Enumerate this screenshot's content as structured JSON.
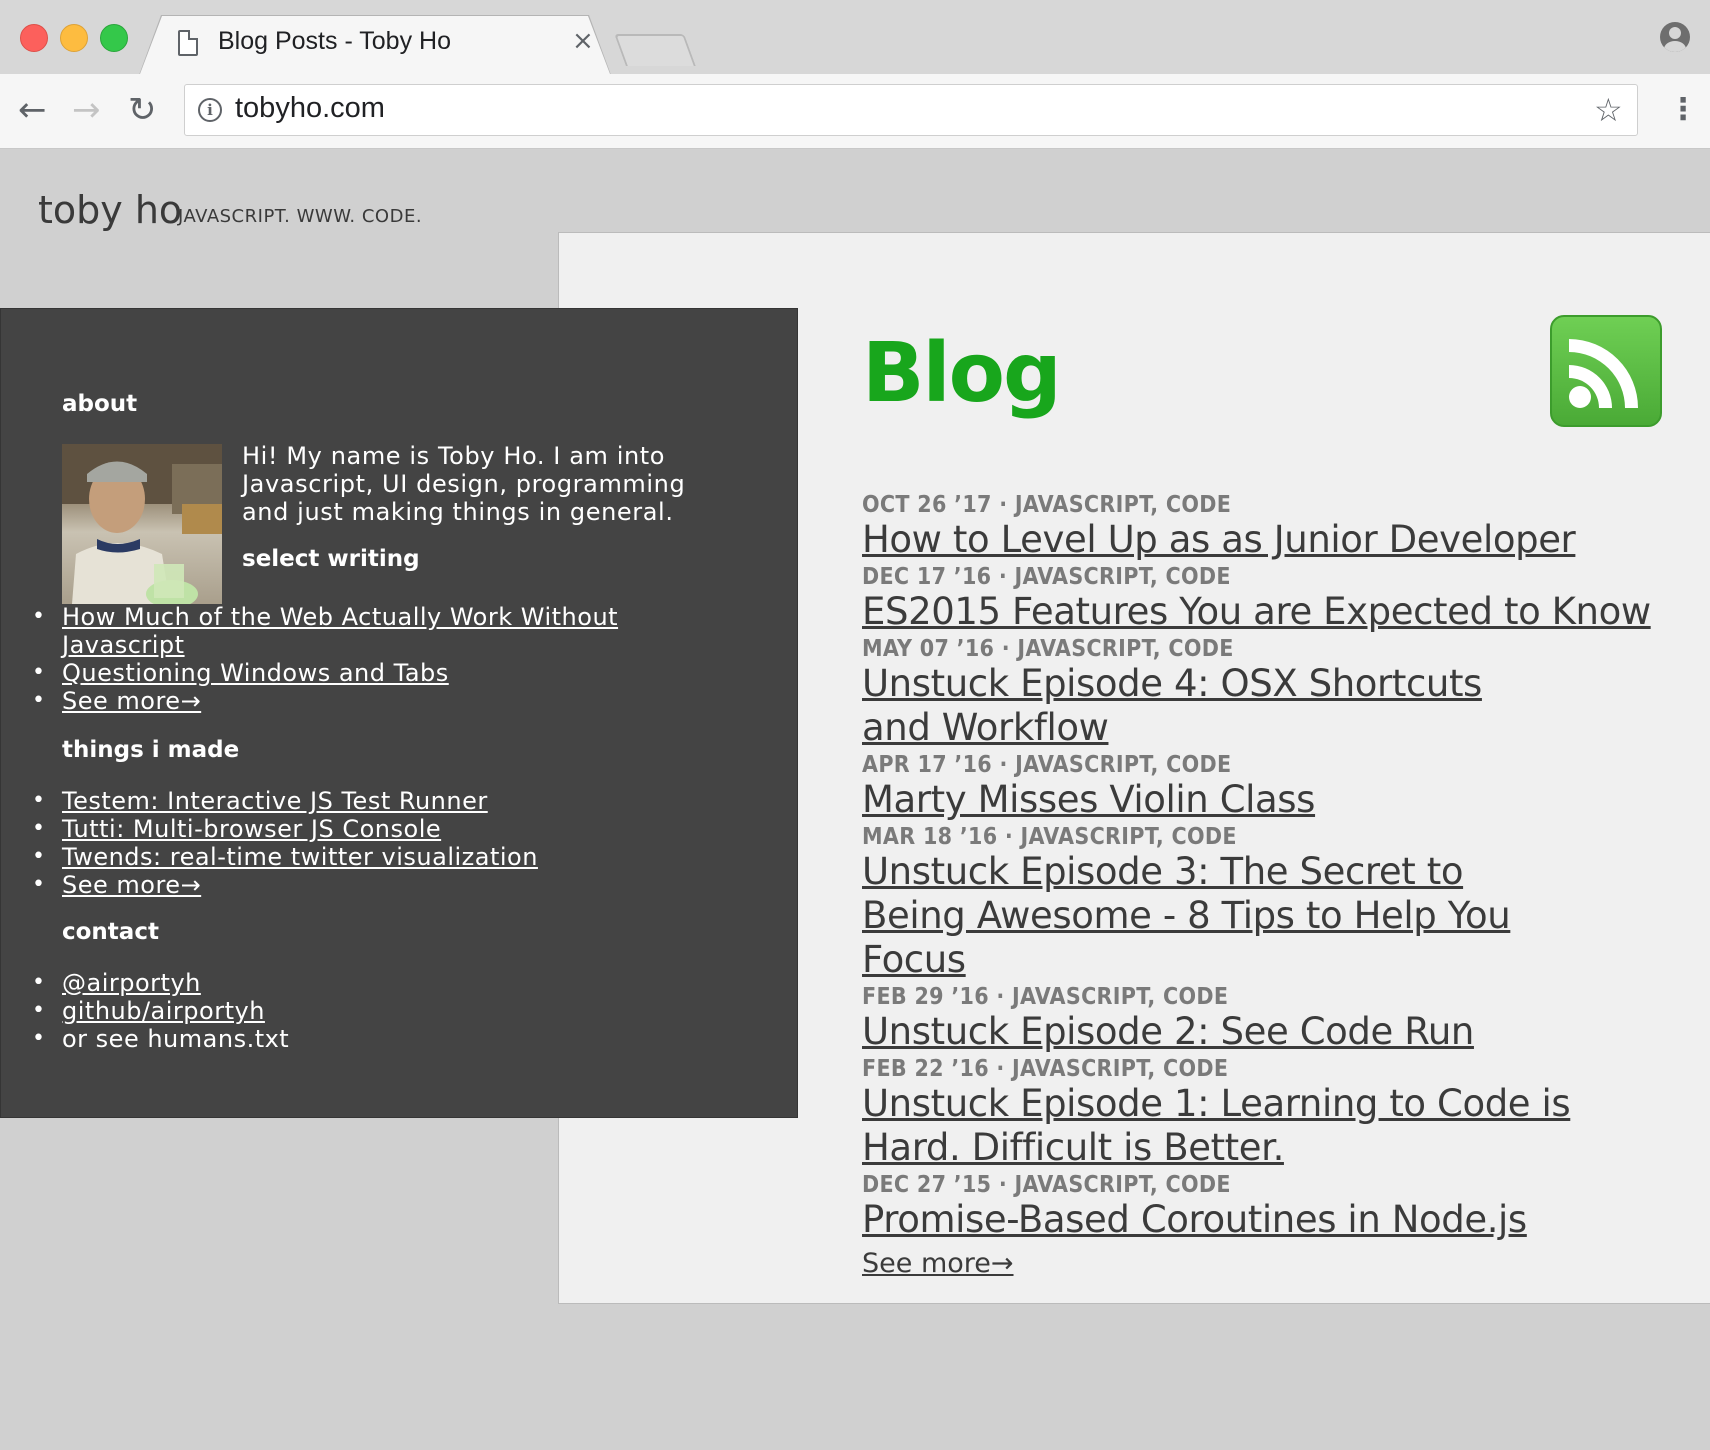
{
  "browser": {
    "tab_title": "Blog Posts - Toby Ho",
    "tab_close": "×",
    "url": "tobyho.com",
    "back": "←",
    "forward": "→",
    "reload": "↻",
    "star": "☆",
    "menu": "⋮",
    "info": "i"
  },
  "site": {
    "title": "toby ho",
    "tagline": "JAVASCRIPT. WWW. CODE."
  },
  "sidebar": {
    "about_heading": "about",
    "bio": "Hi! My name is Toby Ho. I am into Javascript, UI design, programming and just making things in general.",
    "select_writing_heading": "select writing",
    "writing": [
      "How Much of the Web Actually Work Without Javascript",
      "Questioning Windows and Tabs",
      "See more→"
    ],
    "made_heading": "things i made",
    "made": [
      "Testem: Interactive JS Test Runner",
      "Tutti: Multi-browser JS Console",
      "Twends: real-time twitter visualization",
      "See more→"
    ],
    "contact_heading": "contact",
    "contact": [
      "@airportyh",
      "github/airportyh",
      "or see humans.txt"
    ]
  },
  "blog": {
    "heading": "Blog",
    "posts": [
      {
        "meta": "OCT 26 ’17 · JAVASCRIPT, CODE",
        "title": "How to Level Up as as Junior Developer"
      },
      {
        "meta": "DEC 17 ’16 · JAVASCRIPT, CODE",
        "title": "ES2015 Features You are Expected to Know"
      },
      {
        "meta": "MAY 07 ’16 · JAVASCRIPT, CODE",
        "title": "Unstuck Episode 4: OSX Shortcuts and Workflow"
      },
      {
        "meta": "APR 17 ’16 · JAVASCRIPT, CODE",
        "title": "Marty Misses Violin Class"
      },
      {
        "meta": "MAR 18 ’16 · JAVASCRIPT, CODE",
        "title": "Unstuck Episode 3: The Secret to Being Awesome - 8 Tips to Help You Focus"
      },
      {
        "meta": "FEB 29 ’16 · JAVASCRIPT, CODE",
        "title": "Unstuck Episode 2: See Code Run"
      },
      {
        "meta": "FEB 22 ’16 · JAVASCRIPT, CODE",
        "title": "Unstuck Episode 1: Learning to Code is Hard. Difficult is Better."
      },
      {
        "meta": "DEC 27 ’15 · JAVASCRIPT, CODE",
        "title": "Promise-Based Coroutines in Node.js"
      }
    ],
    "see_more": "See more→"
  },
  "colors": {
    "blog_heading": "#18a61c",
    "sidebar_bg": "#444444",
    "page_bg": "#d0d0d0",
    "panel_bg": "#f0f0f0"
  }
}
